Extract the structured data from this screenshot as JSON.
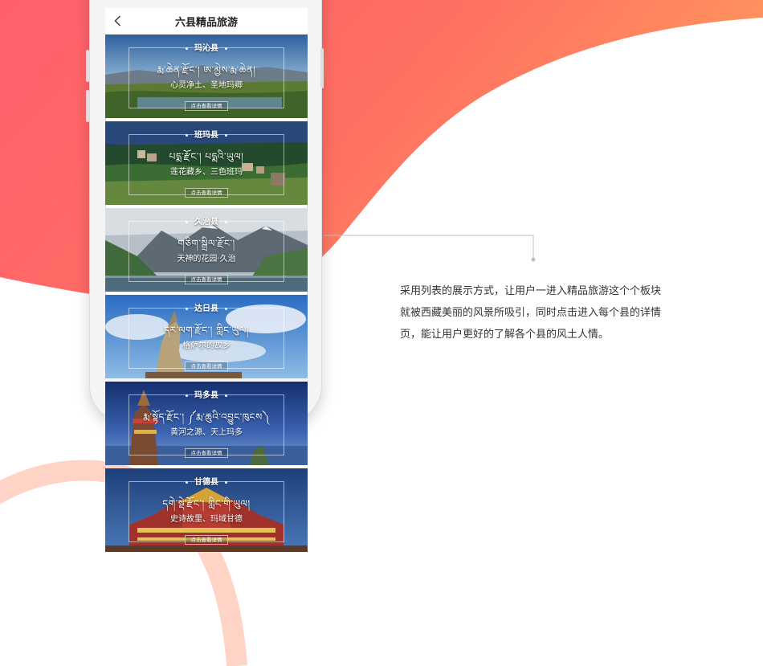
{
  "nav": {
    "title": "六县精品旅游"
  },
  "cards": [
    {
      "name": "玛沁县",
      "tibetan": "རྨ་ཆེན་རྫོང་། ཨ་མྱེས་རྨ་ཆེན།",
      "slogan": "心灵净土、圣地玛卿",
      "detail": "点击查看详情"
    },
    {
      "name": "班玛县",
      "tibetan": "པདྨ་རྫོང་། པདྨའི་ཡུལ།",
      "slogan": "莲花藏乡、三色班玛",
      "detail": "点击查看详情"
    },
    {
      "name": "久治县",
      "tibetan": "གཅིག་སྒྲིལ་རྫོང་།",
      "slogan": "天神的花园·久治",
      "detail": "点击查看详情"
    },
    {
      "name": "达日县",
      "tibetan": "དར་ལག་རྫོང་། གླིང་ཡུལ།",
      "slogan": "格萨尔的故乡",
      "detail": "点击查看详情"
    },
    {
      "name": "玛多县",
      "tibetan": "རྨ་སྟོད་རྫོང་། ༼རྨ་ཆུའི་འབྱུང་ཁུངས༽",
      "slogan": "黄河之源、天上玛多",
      "detail": "点击查看详情"
    },
    {
      "name": "甘德县",
      "tibetan": "དགེ་སྡེ་རྫོང་། གླིང་གི་ཡུལ།",
      "slogan": "史诗故里、玛域甘德",
      "detail": "点击查看详情"
    }
  ],
  "description": "采用列表的展示方式，让用户一进入精品旅游这个个板块就被西藏美丽的风景所吸引，同时点击进入每个县的详情页，能让用户更好的了解各个县的风土人情。",
  "colors": {
    "accent_gradient_start": "#ff5f6d",
    "accent_gradient_end": "#ff9a5c",
    "ring": "#ffc9b9"
  }
}
